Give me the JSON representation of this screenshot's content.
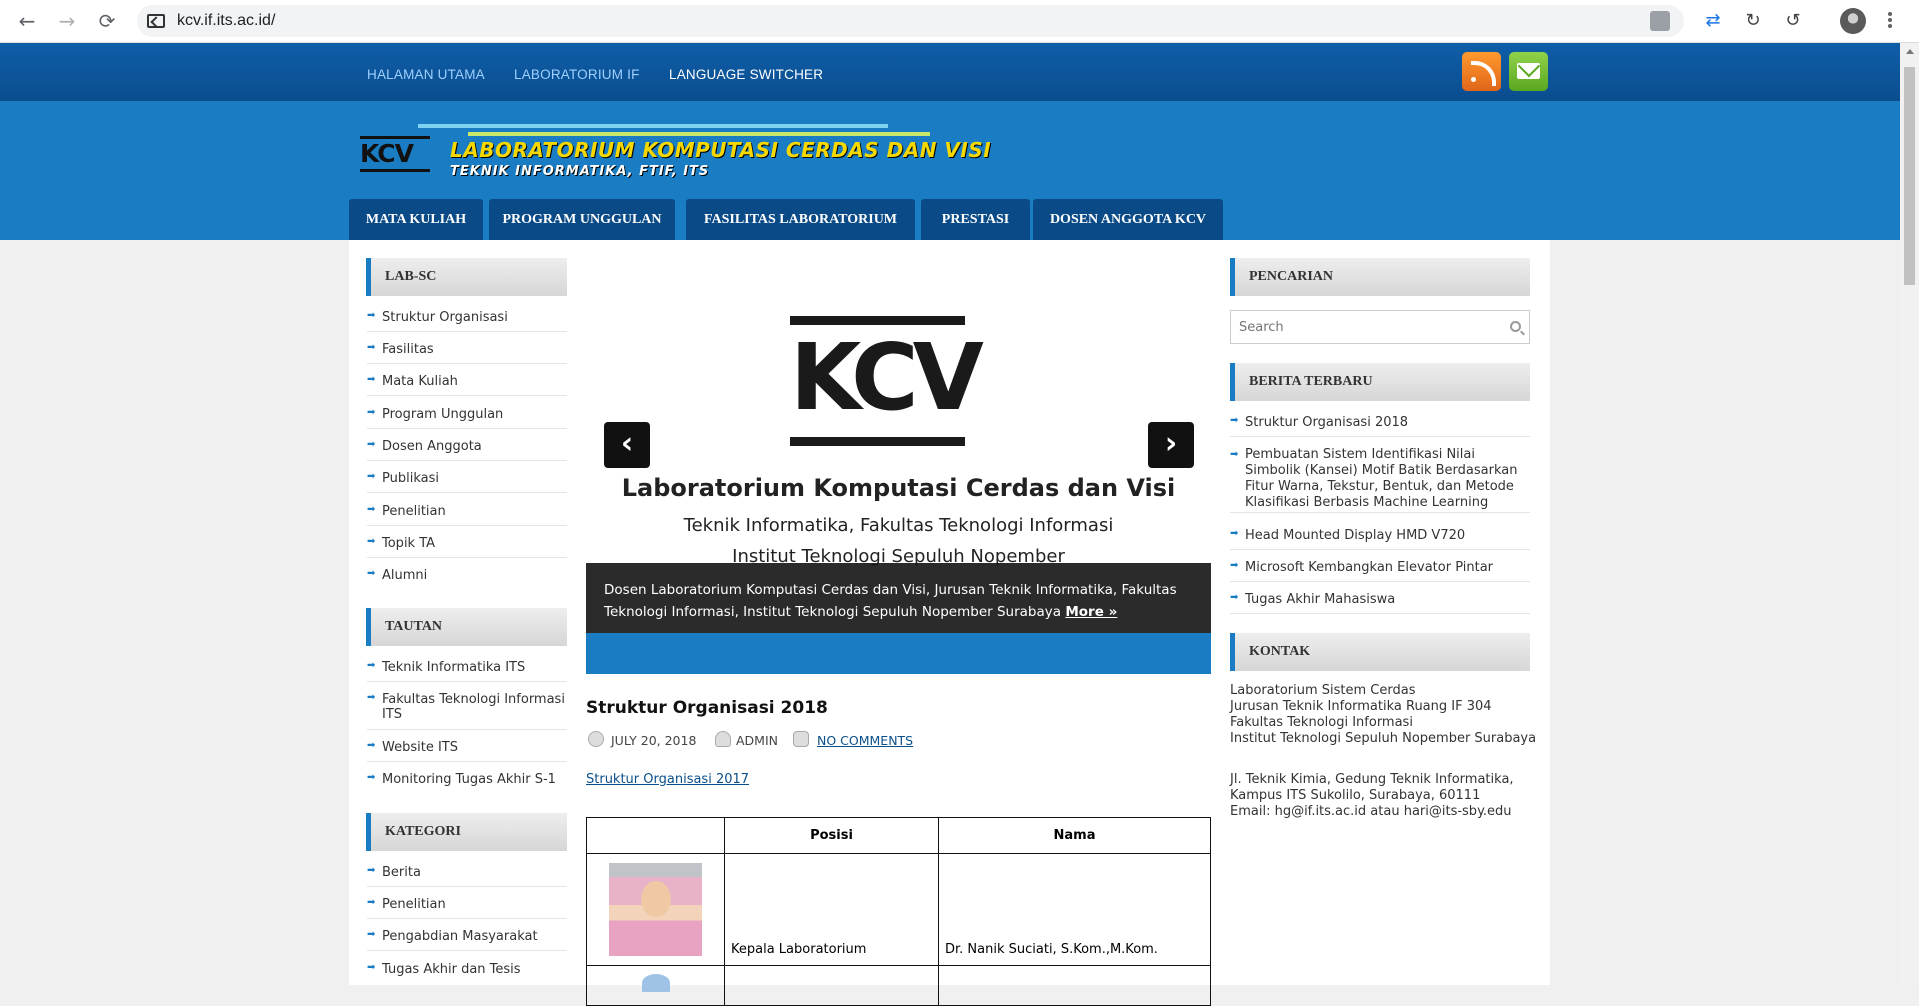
{
  "browser": {
    "url": "kcv.if.its.ac.id/"
  },
  "topnav": {
    "items": [
      "HALAMAN UTAMA",
      "LABORATORIUM IF",
      "LANGUAGE SWITCHER"
    ]
  },
  "logo": {
    "mark": "KCV",
    "title": "LABORATORIUM KOMPUTASI CERDAS DAN VISI",
    "subtitle": "TEKNIK INFORMATIKA, FTIF, ITS"
  },
  "mainnav": {
    "items": [
      "MATA KULIAH",
      "PROGRAM UNGGULAN",
      "FASILITAS LABORATORIUM",
      "PRESTASI",
      "DOSEN ANGGOTA KCV"
    ]
  },
  "left_sidebar": {
    "labsc": {
      "title": "LAB-SC",
      "links": [
        "Struktur Organisasi",
        "Fasilitas",
        "Mata Kuliah",
        "Program Unggulan",
        "Dosen Anggota",
        "Publikasi",
        "Penelitian",
        "Topik TA",
        "Alumni"
      ]
    },
    "tautan": {
      "title": "TAUTAN",
      "links": [
        "Teknik Informatika ITS",
        "Fakultas Teknologi Informasi ITS",
        "Website ITS",
        "Monitoring Tugas Akhir S-1"
      ]
    },
    "kategori": {
      "title": "KATEGORI",
      "links": [
        "Berita",
        "Penelitian",
        "Pengabdian Masyarakat",
        "Tugas Akhir dan Tesis"
      ]
    }
  },
  "slider": {
    "logo_text": "KCV",
    "title": "Laboratorium Komputasi Cerdas dan Visi",
    "line1": "Teknik Informatika, Fakultas Teknologi Informasi",
    "line2": "Institut Teknologi Sepuluh Nopember",
    "caption": "Dosen Laboratorium Komputasi Cerdas dan Visi, Jurusan Teknik Informatika, Fakultas Teknologi Informasi, Institut Teknologi Sepuluh Nopember Surabaya",
    "more": "More »",
    "prev": "‹",
    "next": "›"
  },
  "post": {
    "title": "Struktur Organisasi 2018",
    "date": "JULY 20, 2018",
    "author": "ADMIN",
    "comments": "NO COMMENTS",
    "link": "Struktur Organisasi 2017",
    "table": {
      "headers": [
        "",
        "Posisi",
        "Nama"
      ],
      "rows": [
        {
          "posisi": "Kepala Laboratorium",
          "nama": "Dr. Nanik Suciati, S.Kom.,M.Kom."
        }
      ]
    }
  },
  "right_sidebar": {
    "pencarian": {
      "title": "PENCARIAN",
      "placeholder": "Search"
    },
    "berita": {
      "title": "BERITA TERBARU",
      "links": [
        "Struktur Organisasi 2018",
        "Pembuatan Sistem Identifikasi Nilai Simbolik (Kansei) Motif Batik Berdasarkan Fitur Warna, Tekstur, Bentuk, dan Metode Klasifikasi Berbasis Machine Learning",
        "Head Mounted Display HMD V720",
        "Microsoft Kembangkan Elevator Pintar",
        "Tugas Akhir Mahasiswa"
      ]
    },
    "kontak": {
      "title": "KONTAK",
      "block1": "Laboratorium Sistem Cerdas\nJurusan Teknik Informatika Ruang IF 304\nFakultas Teknologi Informasi\nInstitut Teknologi Sepuluh Nopember Surabaya",
      "block2": "Jl. Teknik Kimia, Gedung Teknik Informatika,\nKampus ITS Sukolilo, Surabaya, 60111\nEmail: hg@if.its.ac.id atau hari@its-sby.edu"
    }
  },
  "icons": {
    "back": "back-arrow-icon",
    "forward": "forward-arrow-icon",
    "reload": "reload-icon",
    "rss": "rss-icon",
    "mail": "mail-icon"
  },
  "colors": {
    "header_blue": "#1a7dc4",
    "nav_dark": "#0a4a86",
    "logo_yellow": "#f5d800"
  }
}
